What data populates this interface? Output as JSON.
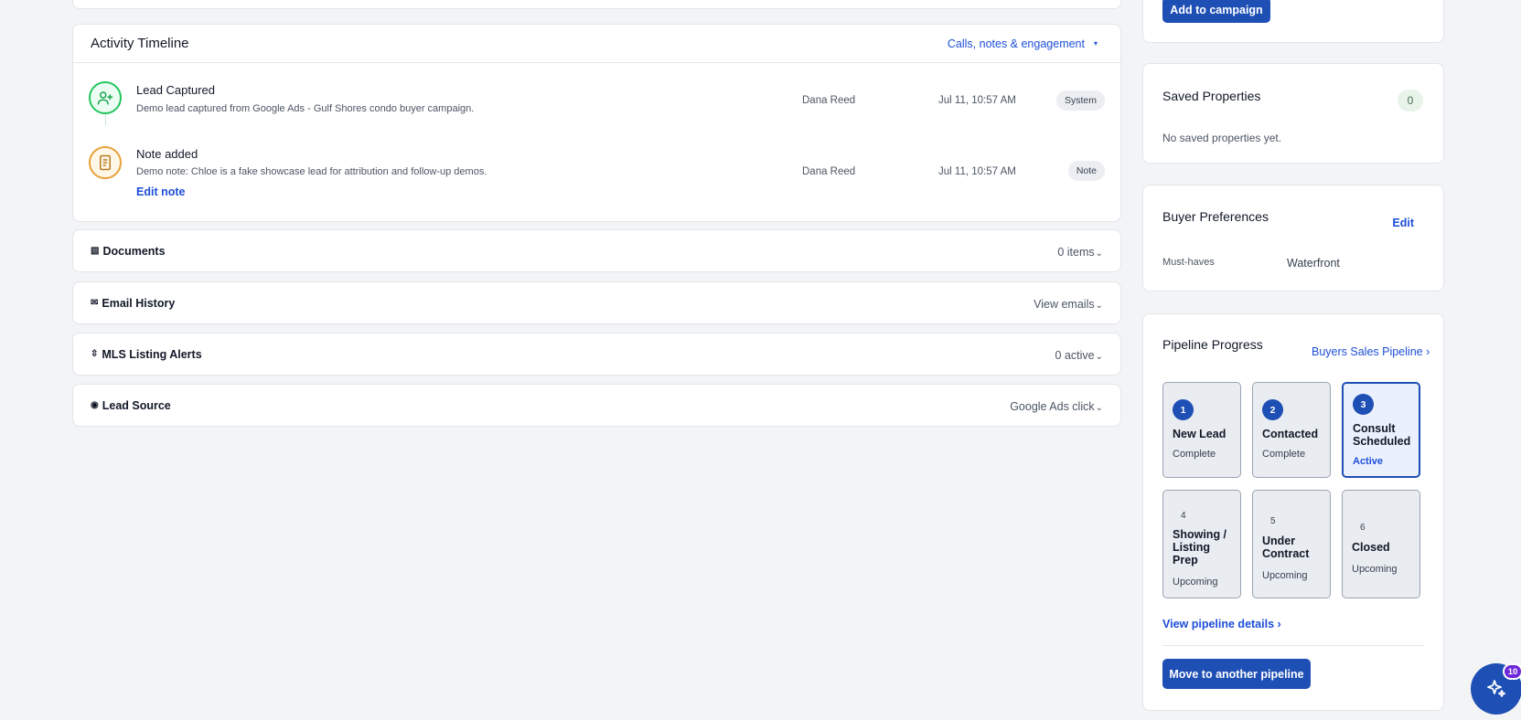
{
  "timeline": {
    "title": "Activity Timeline",
    "filter_label": "Calls, notes & engagement",
    "filter_caret": "▾",
    "events": [
      {
        "icon": "user-plus-icon",
        "title": "Lead Captured",
        "description": "Demo lead captured from Google Ads - Gulf Shores condo buyer campaign.",
        "user": "Dana Reed",
        "time": "Jul 11, 10:57 AM",
        "badge": "System",
        "accent": "#22c55e"
      },
      {
        "icon": "note-icon",
        "title": "Note added",
        "description": "Demo note: Chloe is a fake showcase lead for attribution and follow-up demos.",
        "link": "Edit note",
        "user": "Dana Reed",
        "time": "Jul 11, 10:57 AM",
        "badge": "Note",
        "accent": "#e5a23a"
      }
    ]
  },
  "sections": [
    {
      "icon": "documents-icon",
      "glyph": "▧",
      "title": "Documents",
      "right": "0 items"
    },
    {
      "icon": "mail-icon",
      "glyph": "✉",
      "title": "Email History",
      "right": "View emails"
    },
    {
      "icon": "alert-icon",
      "glyph": "⇳",
      "title": "MLS Listing Alerts",
      "right": "0 active"
    },
    {
      "icon": "target-icon",
      "glyph": "◉",
      "title": "Lead Source",
      "right": "Google Ads click"
    }
  ],
  "section_chevron": "⌄",
  "campaign": {
    "button": "Add to campaign"
  },
  "saved_properties": {
    "title": "Saved Properties",
    "count": "0",
    "empty": "No saved properties yet."
  },
  "buyer_preferences": {
    "title": "Buyer Preferences",
    "edit": "Edit",
    "label": "Must-haves",
    "value": "Waterfront"
  },
  "pipeline": {
    "title": "Pipeline Progress",
    "pipeline_link": "Buyers Sales Pipeline ›",
    "stages": [
      {
        "num": "1",
        "name": "New Lead",
        "status": "Complete"
      },
      {
        "num": "2",
        "name": "Contacted",
        "status": "Complete"
      },
      {
        "num": "3",
        "name": "Consult Scheduled",
        "status": "Active"
      },
      {
        "num": "4",
        "name": "Showing / Listing Prep",
        "status": "Upcoming"
      },
      {
        "num": "5",
        "name": "Under Contract",
        "status": "Upcoming"
      },
      {
        "num": "6",
        "name": "Closed",
        "status": "Upcoming"
      }
    ],
    "details_link": "View pipeline details ›",
    "move_button": "Move to another pipeline"
  },
  "assistant": {
    "icon": "sparkles-icon",
    "badge": "10"
  },
  "colors": {
    "primary": "#1e4fb4",
    "link": "#1d4ed8",
    "background": "#f3f4f6"
  }
}
